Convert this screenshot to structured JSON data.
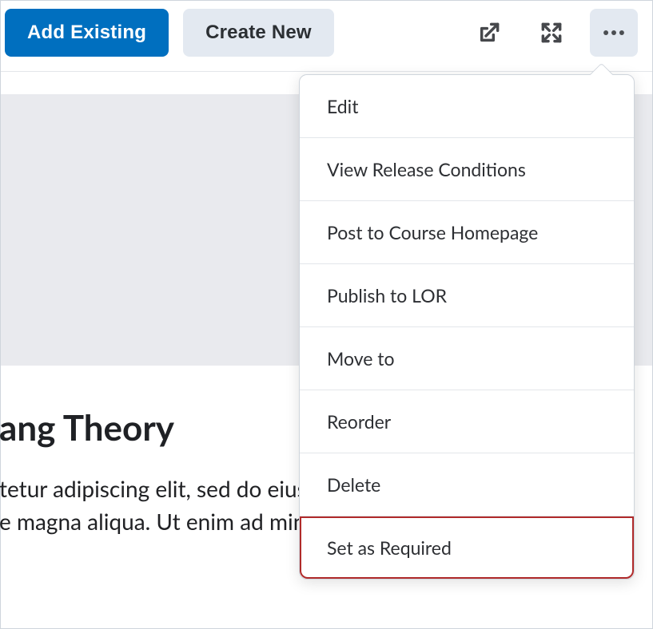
{
  "toolbar": {
    "add_existing_label": "Add Existing",
    "create_new_label": "Create New"
  },
  "dropdown": {
    "items": [
      {
        "label": "Edit",
        "highlighted": false
      },
      {
        "label": "View Release Conditions",
        "highlighted": false
      },
      {
        "label": "Post to Course Homepage",
        "highlighted": false
      },
      {
        "label": "Publish to LOR",
        "highlighted": false
      },
      {
        "label": "Move to",
        "highlighted": false
      },
      {
        "label": "Reorder",
        "highlighted": false
      },
      {
        "label": "Delete",
        "highlighted": false
      },
      {
        "label": "Set as Required",
        "highlighted": true
      }
    ]
  },
  "content": {
    "title_fragment": "ang Theory",
    "body_line1": "tetur adipiscing elit, sed do eiusmod tempor",
    "body_line2": "e magna aliqua. Ut enim ad minim"
  }
}
